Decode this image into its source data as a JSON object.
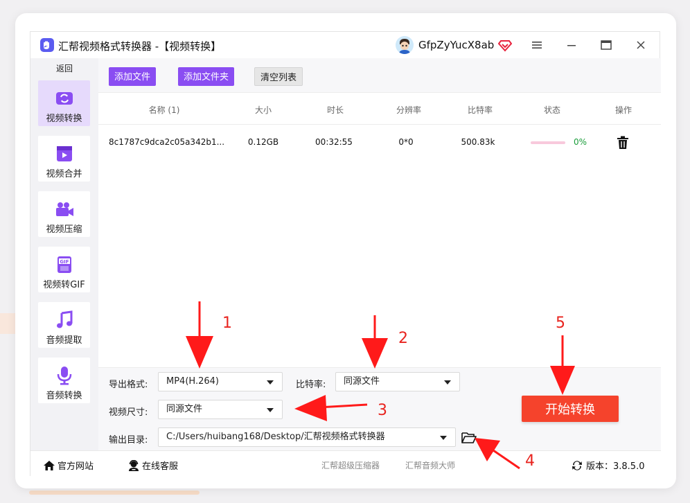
{
  "app": {
    "title": "汇帮视频格式转换器  -【视频转换】",
    "user_name": "GfpZyYucX8ab"
  },
  "sidebar": {
    "back_label": "返回",
    "items": [
      {
        "label": "视频转换",
        "icon": "video-convert-icon"
      },
      {
        "label": "视频合并",
        "icon": "video-merge-icon"
      },
      {
        "label": "视频压缩",
        "icon": "video-compress-icon"
      },
      {
        "label": "视频转GIF",
        "icon": "gif-icon"
      },
      {
        "label": "音频提取",
        "icon": "music-note-icon"
      },
      {
        "label": "音频转换",
        "icon": "microphone-icon"
      }
    ]
  },
  "toolbar": {
    "add_file": "添加文件",
    "add_folder": "添加文件夹",
    "clear_list": "清空列表"
  },
  "table": {
    "columns": [
      "名称 (1)",
      "大小",
      "时长",
      "分辨率",
      "比特率",
      "状态",
      "操作"
    ],
    "rows": [
      {
        "name": "8c1787c9dca2c05a342b1...",
        "size": "0.12GB",
        "duration": "00:32:55",
        "resolution": "0*0",
        "bitrate": "500.83k",
        "progress_percent": 0,
        "progress_text": "0%"
      }
    ]
  },
  "settings": {
    "format_label": "导出格式:",
    "format_value": "MP4(H.264)",
    "bitrate_label": "比特率:",
    "bitrate_value": "同源文件",
    "size_label": "视频尺寸:",
    "size_value": "同源文件",
    "output_label": "输出目录:",
    "output_value": "C:/Users/huibang168/Desktop/汇帮视频格式转换器",
    "start_button": "开始转换"
  },
  "footer": {
    "website": "官方网站",
    "support": "在线客服",
    "link1": "汇帮超级压缩器",
    "link2": "汇帮音频大师",
    "version": "版本：3.8.5.0"
  },
  "annotations": [
    "1",
    "2",
    "3",
    "4",
    "5"
  ],
  "colors": {
    "accent_purple": "#8a4df2",
    "start_red": "#f5432c",
    "annotation_red": "#e8231e",
    "progress_pink": "#f8c9dc",
    "percent_green": "#1a9c3a"
  }
}
